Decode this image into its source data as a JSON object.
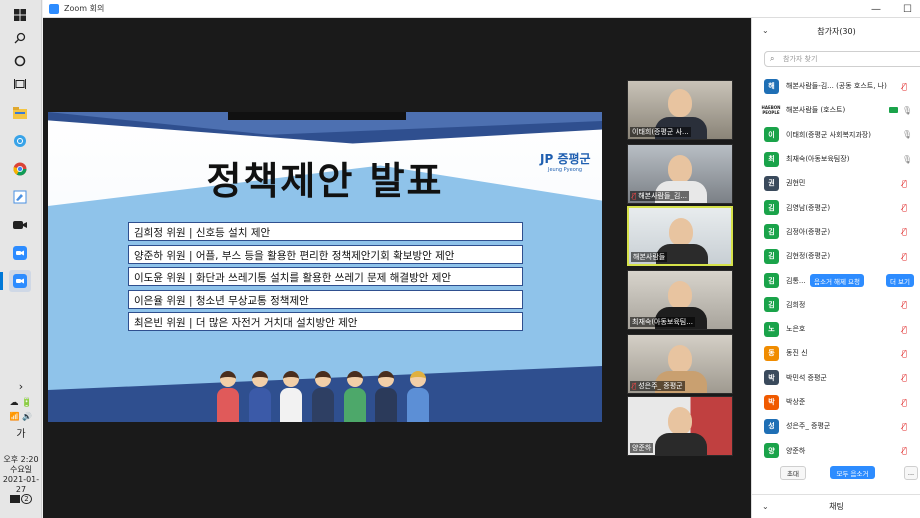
{
  "window": {
    "title": "Zoom 회의"
  },
  "taskbar": {
    "tray_expand": "›",
    "ime": "가",
    "time": "오후 2:20",
    "day": "수요일",
    "date": "2021-01-27",
    "notif_count": "2"
  },
  "slide": {
    "heading": "정책제안 발표",
    "logo_main": "JP 증평군",
    "logo_sub": "Jeung Pyeong",
    "items": [
      "김희정 위원 | 신호등 설치 제안",
      "양준하 위원 | 어플, 부스 등을 활용한 편리한 정책제안기회 확보방안 제안",
      "이도윤 위원 | 화단과 쓰레기통 설치를 활용한 쓰레기 문제 해결방안 제안",
      "이은율 위원 | 청소년 무상교통 정책제안",
      "최은빈 위원 | 더 많은 자전거 거치대 설치방안 제안"
    ]
  },
  "tiles": [
    {
      "name": "이태희(증평군 사...",
      "muted": false
    },
    {
      "name": "해본사람들_김...",
      "muted": true
    },
    {
      "name": "해본사람들",
      "muted": false
    },
    {
      "name": "최재숙(아동보육팀...",
      "muted": false
    },
    {
      "name": "성은주_ 증평군",
      "muted": true
    },
    {
      "name": "양준하",
      "muted": false
    }
  ],
  "panel": {
    "title": "참가자(30)",
    "search_placeholder": "참가자 찾기",
    "participants": [
      {
        "initial": "해",
        "color": "#1f6fb5",
        "name": "해본사람들-김... (공동 호스트, 나)",
        "state": "muted"
      },
      {
        "initial": "HAEBON PEOPLE",
        "color": "logo",
        "name": "해본사람들 (호스트)",
        "state": "cam-mic"
      },
      {
        "initial": "이",
        "color": "#1aa34a",
        "name": "이태희(증평군 사회복지과장)",
        "state": "mic"
      },
      {
        "initial": "최",
        "color": "#1aa34a",
        "name": "최재숙(아동보육팀장)",
        "state": "mic"
      },
      {
        "initial": "권",
        "color": "#3a4a5c",
        "name": "권현민",
        "state": "muted"
      },
      {
        "initial": "김",
        "color": "#1aa34a",
        "name": "김영남(증평군)",
        "state": "muted"
      },
      {
        "initial": "김",
        "color": "#1aa34a",
        "name": "김정아(증평군)",
        "state": "muted"
      },
      {
        "initial": "김",
        "color": "#1aa34a",
        "name": "김현정(증평군)",
        "state": "muted"
      },
      {
        "initial": "김",
        "color": "#1aa34a",
        "name": "김통...",
        "state": "actions"
      },
      {
        "initial": "김",
        "color": "#1aa34a",
        "name": "김희정",
        "state": "muted"
      },
      {
        "initial": "노",
        "color": "#1aa34a",
        "name": "노은호",
        "state": "muted"
      },
      {
        "initial": "동",
        "color": "#f08c00",
        "name": "동진 신",
        "state": "muted"
      },
      {
        "initial": "박",
        "color": "#3a4a5c",
        "name": "박민석 증평군",
        "state": "muted"
      },
      {
        "initial": "박",
        "color": "#f05a00",
        "name": "박상준",
        "state": "muted"
      },
      {
        "initial": "성",
        "color": "#1f6fb5",
        "name": "성은주_ 증평군",
        "state": "muted"
      },
      {
        "initial": "양",
        "color": "#1aa34a",
        "name": "양준하",
        "state": "muted"
      }
    ],
    "row_actions": {
      "unmute_request": "음소거 해제 요청",
      "more": "더 보기"
    },
    "invite": "초대",
    "mute_all": "모두 음소거",
    "more_options": "...",
    "chat": "채팅"
  },
  "colors": {
    "zoom_blue": "#2d8cff",
    "muted_red": "#e02828",
    "speaker_border": "#d6e24a"
  }
}
